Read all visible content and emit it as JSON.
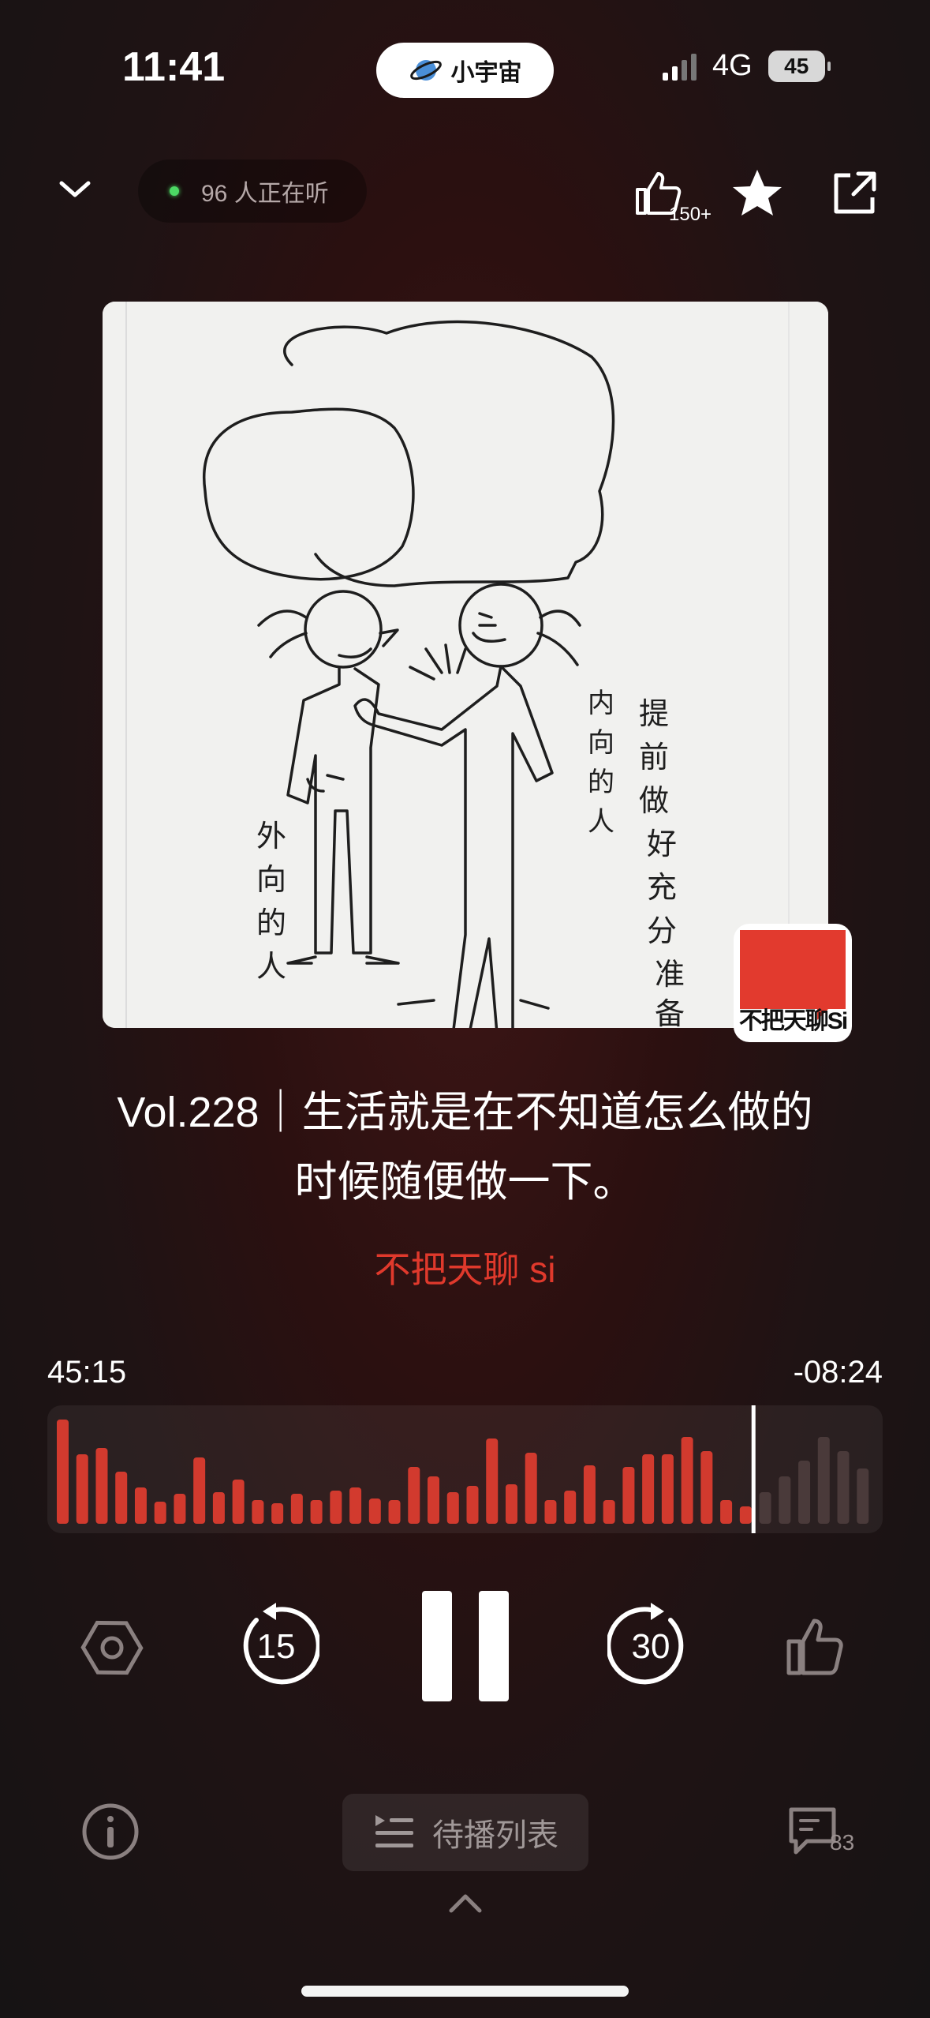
{
  "status_bar": {
    "time": "11:41",
    "app_pill_label": "小宇宙",
    "network": "4G",
    "battery": "45"
  },
  "header": {
    "listeners_text": "96 人正在听",
    "like_count": "150+"
  },
  "cover": {
    "badge_label": "不把天聊Si",
    "drawing_text_left": "外向的人",
    "drawing_text_mid": "内向的人",
    "drawing_text_right": "提前做好充分准备"
  },
  "episode": {
    "title_line1": "Vol.228｜生活就是在不知道怎么做的",
    "title_line2": "时候随便做一下。",
    "podcast_name": "不把天聊 si"
  },
  "player": {
    "elapsed": "45:15",
    "remaining": "-08:24",
    "progress_fraction": 0.843,
    "skip_back_seconds": "15",
    "skip_forward_seconds": "30",
    "state": "playing"
  },
  "bottom": {
    "queue_label": "待播列表",
    "comment_count": "83"
  },
  "colors": {
    "accent": "#e0392c",
    "played_bar": "#d23a2e",
    "unplayed_bar": "#4a3a3a"
  }
}
